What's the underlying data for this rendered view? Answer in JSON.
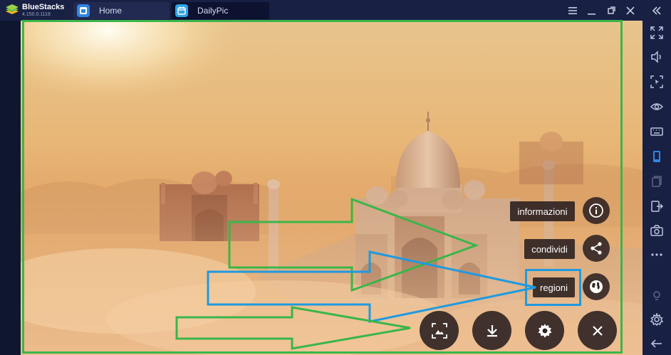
{
  "app": {
    "brand": "BlueStacks",
    "version": "4.150.0.1118"
  },
  "tabs": [
    {
      "label": "Home",
      "active": false
    },
    {
      "label": "DailyPic",
      "active": true
    }
  ],
  "window_controls": [
    "menu-icon",
    "minimize-icon",
    "restore-icon",
    "close-icon",
    "collapse-icon"
  ],
  "sidebar_tools": [
    "fullscreen-icon",
    "volume-icon",
    "screenshot-area-icon",
    "eye-icon",
    "keyboard-icon",
    "phone-icon",
    "copy-icon",
    "import-icon",
    "camera-icon",
    "more-icon",
    "bulb-icon",
    "settings-icon",
    "back-icon"
  ],
  "menu": {
    "info_label": "informazioni",
    "share_label": "condividi",
    "regions_label": "regioni"
  },
  "colors": {
    "titlebar": "#182044",
    "annotation_green": "#3bb54a",
    "annotation_blue": "#1e9ae0",
    "fab_bg": "#2d2121"
  }
}
